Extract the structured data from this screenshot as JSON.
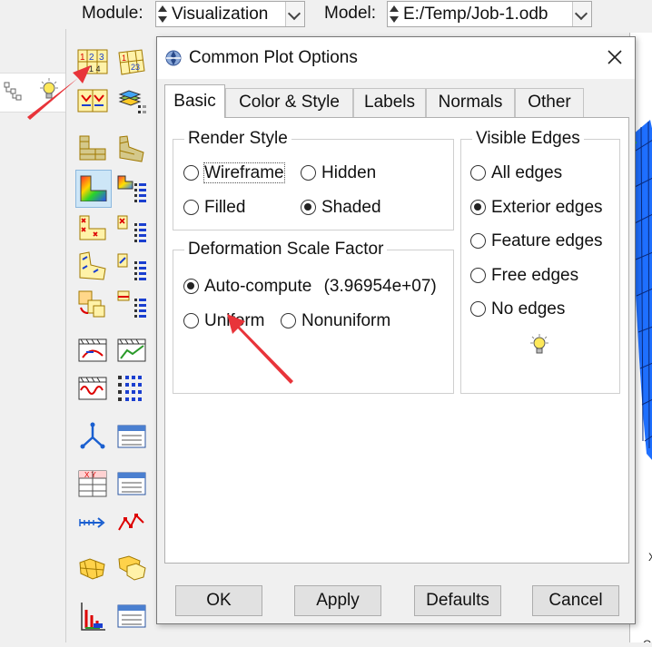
{
  "toolbar": {
    "module_label": "Module:",
    "module_value": "Visualization",
    "model_label": "Model:",
    "model_value": "E:/Temp/Job-1.odb"
  },
  "dialog": {
    "title": "Common Plot Options",
    "tabs": [
      "Basic",
      "Color & Style",
      "Labels",
      "Normals",
      "Other"
    ],
    "active_tab": "Basic",
    "render_style": {
      "legend": "Render Style",
      "options": [
        "Wireframe",
        "Hidden",
        "Filled",
        "Shaded"
      ],
      "selected": "Shaded"
    },
    "deformation": {
      "legend": "Deformation Scale Factor",
      "auto_label": "Auto-compute",
      "auto_value": "(3.96954e+07)",
      "uniform_label": "Uniform",
      "nonuniform_label": "Nonuniform",
      "selected": "Auto-compute"
    },
    "visible_edges": {
      "legend": "Visible Edges",
      "options": [
        "All edges",
        "Exterior edges",
        "Feature edges",
        "Free edges",
        "No edges"
      ],
      "selected": "Exterior edges"
    },
    "buttons": {
      "ok": "OK",
      "apply": "Apply",
      "defaults": "Defaults",
      "cancel": "Cancel"
    }
  },
  "colors": {
    "annotation_arrow": "#e8343a",
    "viewport_mesh": "#1e6fff"
  }
}
